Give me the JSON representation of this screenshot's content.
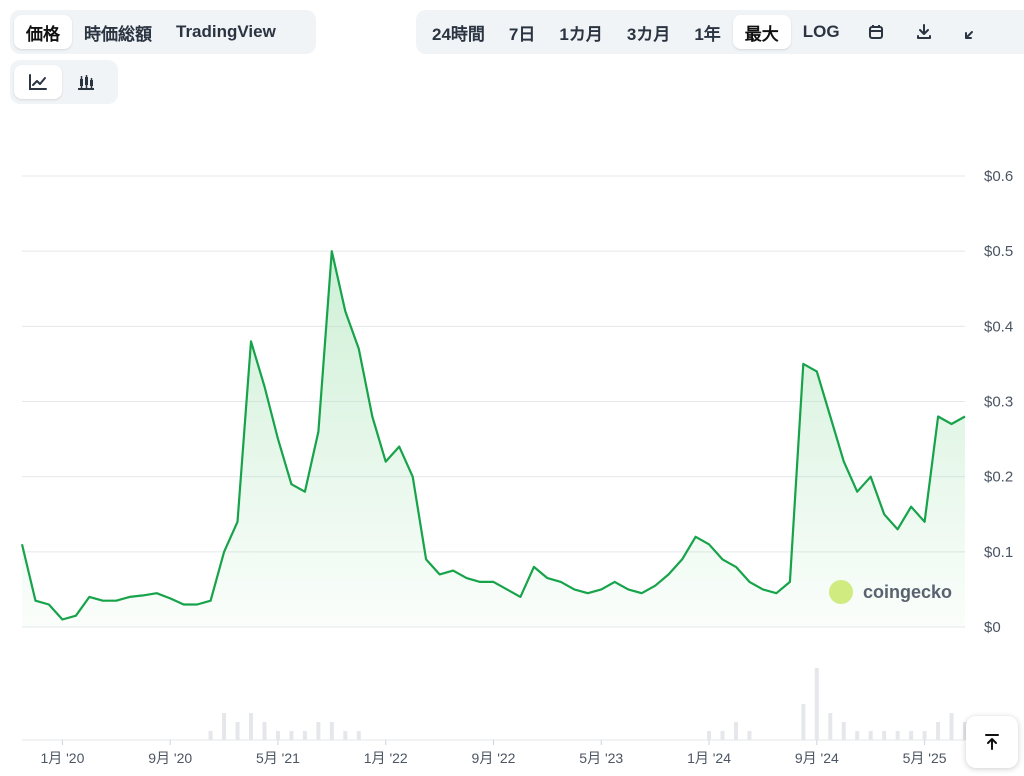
{
  "tabs_main": [
    "価格",
    "時価総額",
    "TradingView"
  ],
  "tabs_range": [
    "24時間",
    "7日",
    "1カ月",
    "3カ月",
    "1年",
    "最大",
    "LOG"
  ],
  "active_main": "価格",
  "active_range": "最大",
  "range_icons": [
    "calendar-icon",
    "download-icon",
    "expand-icon"
  ],
  "chart_type_icons": [
    "line-chart-icon",
    "candlestick-chart-icon"
  ],
  "watermark": "coingecko",
  "colors": {
    "line": "#16a34a",
    "fill_top": "#a7e3b5",
    "grid": "#e5e7eb",
    "volume": "#e5e7eb"
  },
  "chart_data": {
    "type": "area",
    "y_ticks": [
      "$0",
      "$0.1",
      "$0.2",
      "$0.3",
      "$0.4",
      "$0.5",
      "$0.6"
    ],
    "ylim": [
      0,
      0.6
    ],
    "x_ticks": [
      "1月 '20",
      "9月 '20",
      "5月 '21",
      "1月 '22",
      "9月 '22",
      "5月 '23",
      "1月 '24",
      "9月 '24",
      "5月 '25"
    ],
    "x_range": [
      "2019-10",
      "2025-08"
    ],
    "grid": true,
    "x": [
      "2019-10",
      "2019-11",
      "2019-12",
      "2020-01",
      "2020-02",
      "2020-03",
      "2020-04",
      "2020-05",
      "2020-06",
      "2020-07",
      "2020-08",
      "2020-09",
      "2020-10",
      "2020-11",
      "2020-12",
      "2021-01",
      "2021-02",
      "2021-03",
      "2021-04",
      "2021-05",
      "2021-06",
      "2021-07",
      "2021-08",
      "2021-09",
      "2021-10",
      "2021-11",
      "2021-12",
      "2022-01",
      "2022-02",
      "2022-03",
      "2022-04",
      "2022-05",
      "2022-06",
      "2022-07",
      "2022-08",
      "2022-09",
      "2022-10",
      "2022-11",
      "2022-12",
      "2023-01",
      "2023-02",
      "2023-03",
      "2023-04",
      "2023-05",
      "2023-06",
      "2023-07",
      "2023-08",
      "2023-09",
      "2023-10",
      "2023-11",
      "2023-12",
      "2024-01",
      "2024-02",
      "2024-03",
      "2024-04",
      "2024-05",
      "2024-06",
      "2024-07",
      "2024-08",
      "2024-09",
      "2024-10",
      "2024-11",
      "2024-12",
      "2025-01",
      "2025-02",
      "2025-03",
      "2025-04",
      "2025-05",
      "2025-06",
      "2025-07",
      "2025-08"
    ],
    "series": [
      {
        "values": [
          0.11,
          0.035,
          0.03,
          0.01,
          0.015,
          0.04,
          0.035,
          0.035,
          0.04,
          0.042,
          0.045,
          0.038,
          0.03,
          0.03,
          0.035,
          0.1,
          0.14,
          0.38,
          0.32,
          0.25,
          0.19,
          0.18,
          0.26,
          0.5,
          0.42,
          0.37,
          0.28,
          0.22,
          0.24,
          0.2,
          0.09,
          0.07,
          0.075,
          0.065,
          0.06,
          0.06,
          0.05,
          0.04,
          0.08,
          0.065,
          0.06,
          0.05,
          0.045,
          0.05,
          0.06,
          0.05,
          0.045,
          0.055,
          0.07,
          0.09,
          0.12,
          0.11,
          0.09,
          0.08,
          0.06,
          0.05,
          0.045,
          0.06,
          0.35,
          0.34,
          0.28,
          0.22,
          0.18,
          0.2,
          0.15,
          0.13,
          0.16,
          0.14,
          0.28,
          0.27,
          0.28
        ]
      }
    ],
    "volume": [
      0,
      0,
      0,
      0,
      0,
      0,
      0,
      0,
      0,
      0,
      0,
      0,
      0,
      0,
      0.01,
      0.03,
      0.02,
      0.03,
      0.02,
      0.01,
      0.01,
      0.01,
      0.02,
      0.02,
      0.01,
      0.01,
      0,
      0,
      0,
      0,
      0,
      0,
      0,
      0,
      0,
      0,
      0,
      0,
      0,
      0,
      0,
      0,
      0,
      0,
      0,
      0,
      0,
      0,
      0,
      0,
      0,
      0.01,
      0.01,
      0.02,
      0.01,
      0,
      0,
      0,
      0.04,
      0.08,
      0.03,
      0.02,
      0.01,
      0.01,
      0.01,
      0.01,
      0.01,
      0.01,
      0.02,
      0.03,
      0.02
    ]
  }
}
